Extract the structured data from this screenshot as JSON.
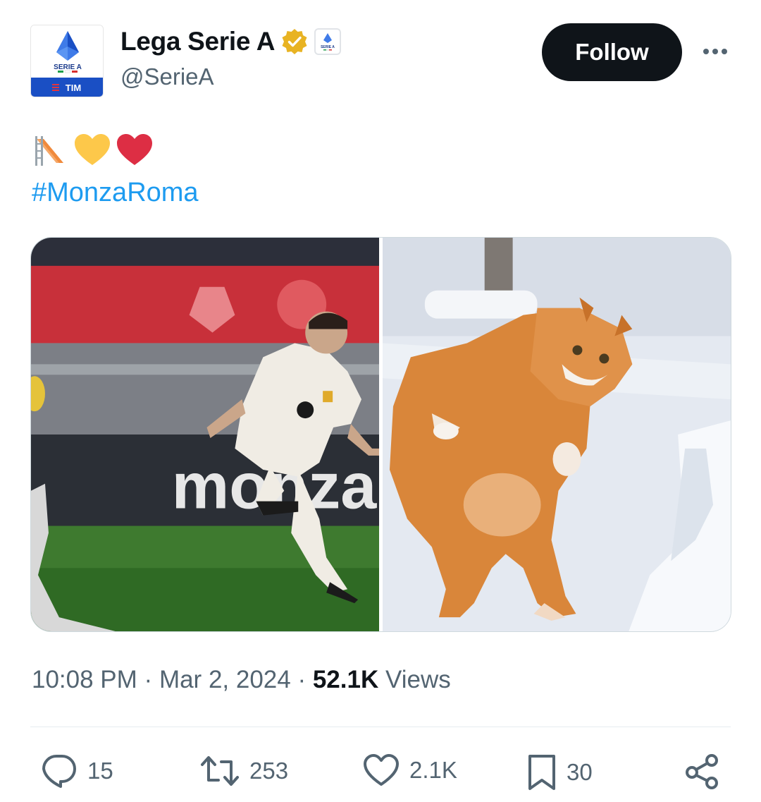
{
  "author": {
    "display_name": "Lega Serie A",
    "handle": "@SerieA",
    "avatar_top_text": "SERIE A",
    "avatar_bottom_text": "TIM",
    "affiliate_badge_text": "SERIE A",
    "verified_badge": "gold-check-icon"
  },
  "header": {
    "follow_label": "Follow",
    "more_icon": "more-dots-icon"
  },
  "tweet": {
    "emojis": [
      "slide-emoji",
      "yellow-heart-emoji",
      "red-heart-emoji"
    ],
    "hashtag": "#MonzaRoma",
    "media": [
      {
        "name": "photo-football-player",
        "background_text": "monza"
      },
      {
        "name": "photo-orange-cat-in-snow"
      }
    ]
  },
  "meta": {
    "time": "10:08 PM",
    "separator": "·",
    "date": "Mar 2, 2024",
    "views_count": "52.1K",
    "views_label": "Views"
  },
  "actions": {
    "replies": "15",
    "reposts": "253",
    "likes": "2.1K",
    "bookmarks": "30"
  },
  "colors": {
    "link": "#1d9bf0",
    "secondary_text": "#536471",
    "primary_text": "#0f1419",
    "verified_gold": "#e8b323",
    "avatar_blue": "#1a4fc4"
  }
}
